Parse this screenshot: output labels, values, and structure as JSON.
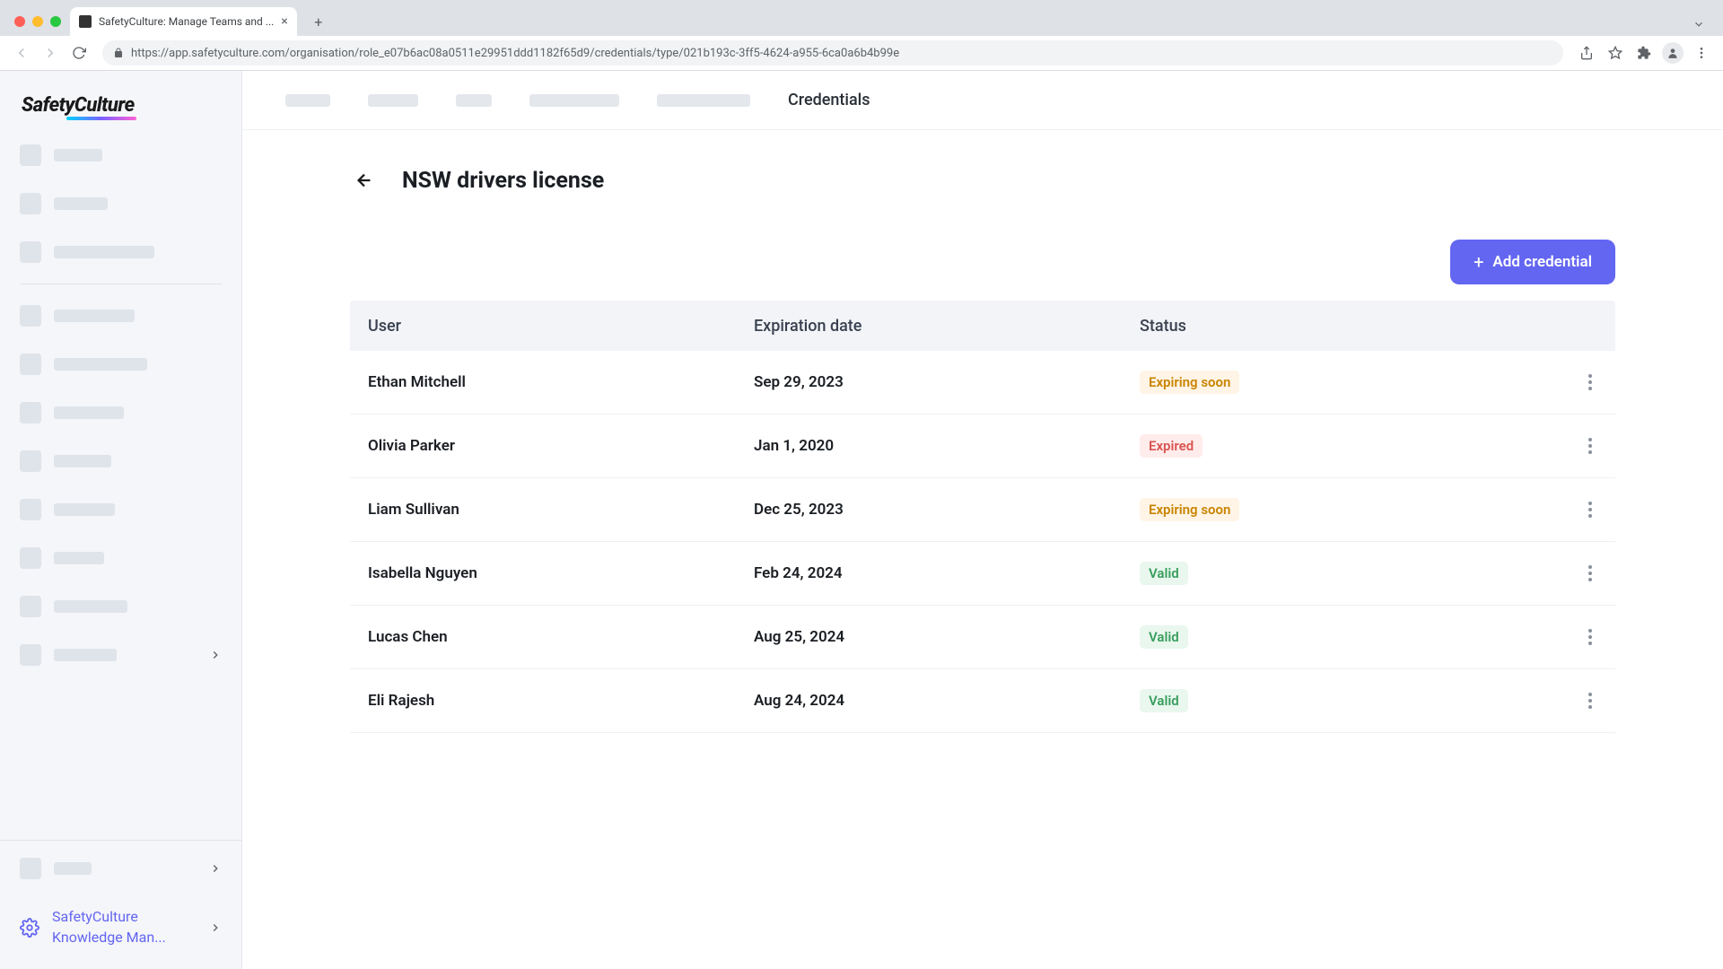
{
  "browser": {
    "tab_title": "SafetyCulture: Manage Teams and ...",
    "url": "https://app.safetyculture.com/organisation/role_e07b6ac08a0511e29951ddd1182f65d9/credentials/type/021b193c-3ff5-4624-a955-6ca0a6b4b99e"
  },
  "logo": "SafetyCulture",
  "sidebar": {
    "knowledge_label": "SafetyCulture Knowledge Man..."
  },
  "topbar": {
    "credentials_label": "Credentials"
  },
  "page": {
    "title": "NSW drivers license",
    "add_button": "Add credential"
  },
  "table": {
    "headers": {
      "user": "User",
      "expiration": "Expiration date",
      "status": "Status"
    },
    "rows": [
      {
        "user": "Ethan Mitchell",
        "expiration": "Sep 29, 2023",
        "status": "Expiring soon",
        "status_kind": "expiring"
      },
      {
        "user": "Olivia Parker",
        "expiration": "Jan 1, 2020",
        "status": "Expired",
        "status_kind": "expired"
      },
      {
        "user": "Liam Sullivan",
        "expiration": "Dec 25, 2023",
        "status": "Expiring soon",
        "status_kind": "expiring"
      },
      {
        "user": "Isabella Nguyen",
        "expiration": "Feb 24, 2024",
        "status": "Valid",
        "status_kind": "valid"
      },
      {
        "user": "Lucas Chen",
        "expiration": "Aug 25, 2024",
        "status": "Valid",
        "status_kind": "valid"
      },
      {
        "user": "Eli Rajesh",
        "expiration": "Aug 24, 2024",
        "status": "Valid",
        "status_kind": "valid"
      }
    ]
  }
}
